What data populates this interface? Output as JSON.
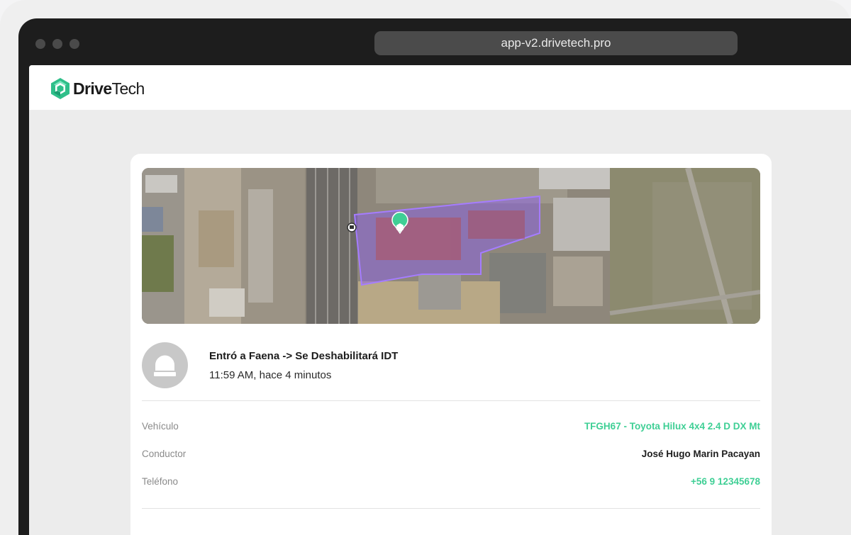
{
  "browser": {
    "url": "app-v2.drivetech.pro"
  },
  "app": {
    "brand_bold": "Drive",
    "brand_light": "Tech",
    "colors": {
      "accent": "#3fcf95",
      "geofence": "#8a5cf5"
    }
  },
  "event": {
    "title": "Entró a Faena -> Se Deshabilitará IDT",
    "time": "11:59 AM, hace 4 minutos",
    "icon": "alarm-light-icon"
  },
  "details": {
    "vehicle_label": "Vehículo",
    "vehicle_value": "TFGH67 - Toyota Hilux 4x4 2.4 D DX Mt",
    "driver_label": "Conductor",
    "driver_value": "José Hugo Marin Pacayan",
    "phone_label": "Teléfono",
    "phone_value": "+56 9 12345678"
  }
}
